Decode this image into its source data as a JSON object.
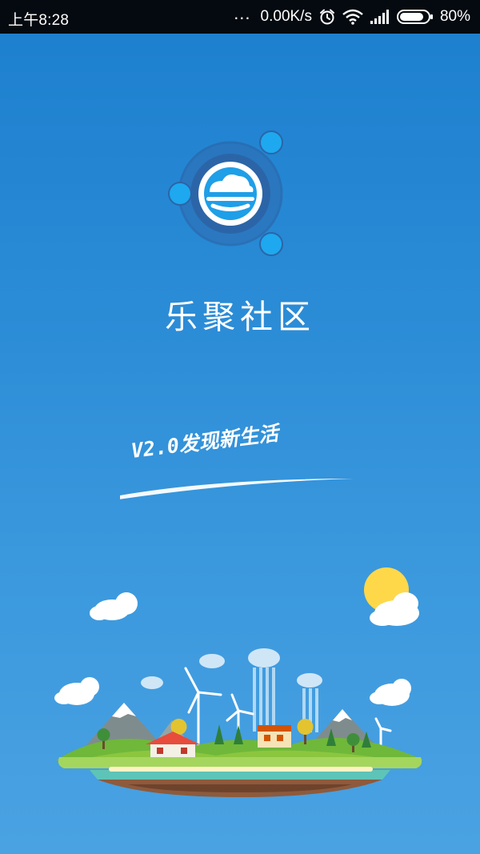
{
  "status_bar": {
    "time": "上午8:28",
    "dots": "...",
    "speed": "0.00K/s",
    "battery": "80%",
    "icons": [
      "alarm-icon",
      "wifi-icon",
      "signal-icon",
      "battery-icon"
    ]
  },
  "splash": {
    "app_name": "乐聚社区",
    "slogan": "V2.0发现新生活"
  },
  "colors": {
    "background_top": "#1c7fce",
    "background_bottom": "#4aa2e2",
    "logo_ring": "#2e62a8",
    "logo_accent": "#1ea8ef",
    "sun": "#ffd84a",
    "grass": "#8cc63f"
  }
}
